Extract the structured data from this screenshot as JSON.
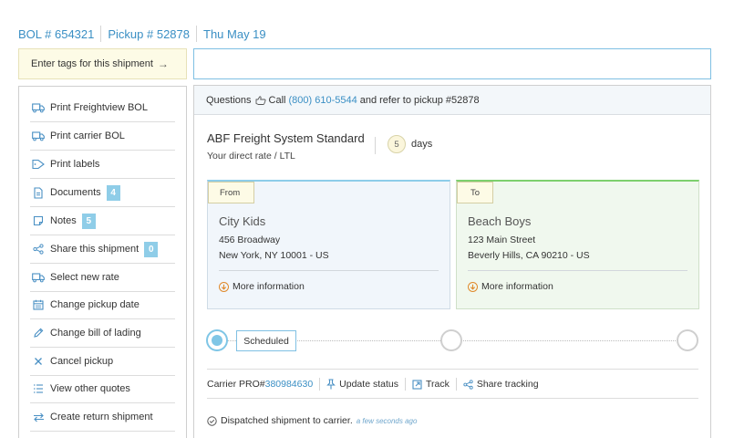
{
  "header": {
    "bol": "BOL # 654321",
    "pickup": "Pickup # 52878",
    "date": "Thu May 19"
  },
  "tags": {
    "label": "Enter tags for this shipment",
    "arrow": "→",
    "input_value": ""
  },
  "sidebar": {
    "items": [
      {
        "label": "Print Freightview BOL",
        "icon": "truck-icon"
      },
      {
        "label": "Print carrier BOL",
        "icon": "truck-icon"
      },
      {
        "label": "Print labels",
        "icon": "tag-icon"
      },
      {
        "label": "Documents",
        "icon": "document-icon",
        "badge": "4"
      },
      {
        "label": "Notes",
        "icon": "note-icon",
        "badge": "5"
      },
      {
        "label": "Share this shipment",
        "icon": "share-icon",
        "badge": "0"
      },
      {
        "label": "Select new rate",
        "icon": "truck-icon"
      },
      {
        "label": "Change pickup date",
        "icon": "calendar-icon"
      },
      {
        "label": "Change bill of lading",
        "icon": "pencil-icon"
      },
      {
        "label": "Cancel pickup",
        "icon": "close-icon"
      },
      {
        "label": "View other quotes",
        "icon": "list-icon"
      },
      {
        "label": "Create return shipment",
        "icon": "return-arrows-icon"
      }
    ]
  },
  "questions": {
    "prefix": "Questions",
    "call": "Call",
    "phone": "(800) 610-5544",
    "suffix": "and refer to pickup #52878"
  },
  "carrier": {
    "name": "ABF Freight System Standard",
    "rate_type": "Your direct rate / LTL",
    "transit_days": "5",
    "days_label": "days"
  },
  "origin": {
    "tag": "From",
    "name": "City Kids",
    "address1": "456 Broadway",
    "address2": "New York, NY 10001 - US",
    "more": "More information"
  },
  "destination": {
    "tag": "To",
    "name": "Beach Boys",
    "address1": "123 Main Street",
    "address2": "Beverly Hills, CA 90210 - US",
    "more": "More information"
  },
  "progress": {
    "current_label": "Scheduled",
    "steps_total": 3,
    "current_step": 1
  },
  "tracking": {
    "pro_label": "Carrier PRO#",
    "pro_number": "380984630",
    "update_status": "Update status",
    "track": "Track",
    "share_tracking": "Share tracking"
  },
  "history": {
    "event": "Dispatched shipment to carrier.",
    "time_ago": "a few seconds ago"
  },
  "colors": {
    "accent": "#3a8fc4",
    "badge": "#8fcde8",
    "from_border": "#8ecde9",
    "to_border": "#7dd06e",
    "tag_bg": "#fdfbe6",
    "info_icon": "#e08a2c"
  }
}
